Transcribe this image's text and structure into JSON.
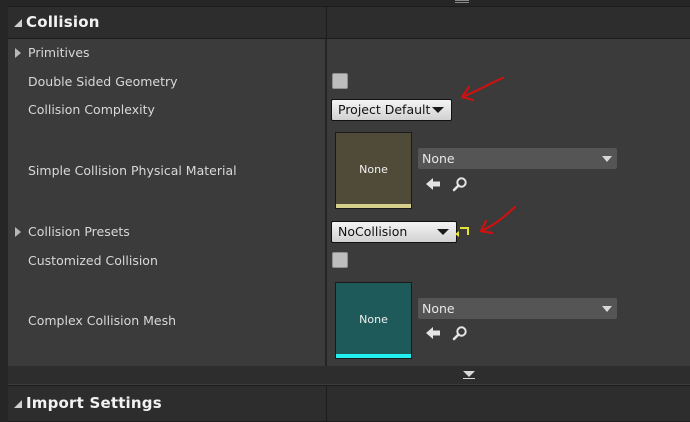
{
  "collision_section": {
    "title": "Collision",
    "properties": {
      "primitives": "Primitives",
      "double_sided_geometry": "Double Sided Geometry",
      "collision_complexity": {
        "label": "Collision Complexity",
        "value": "Project Default"
      },
      "simple_collision_physical_material": {
        "label": "Simple Collision Physical Material",
        "thumbnail_text": "None",
        "dropdown_value": "None"
      },
      "collision_presets": {
        "label": "Collision Presets",
        "value": "NoCollision"
      },
      "customized_collision": "Customized Collision",
      "complex_collision_mesh": {
        "label": "Complex Collision Mesh",
        "thumbnail_text": "None",
        "dropdown_value": "None"
      }
    }
  },
  "import_section": {
    "title": "Import Settings"
  },
  "colors": {
    "panel_background": "#3b3b3b",
    "header_background": "#2d2d2d",
    "physical_material_thumb": "#4f4b38",
    "physical_material_bar": "#d6cf8c",
    "mesh_thumb": "#1e5a5a",
    "mesh_bar": "#22f0f0",
    "reset_to_default": "#e6e233",
    "annotation_arrow": "#cc1111"
  }
}
